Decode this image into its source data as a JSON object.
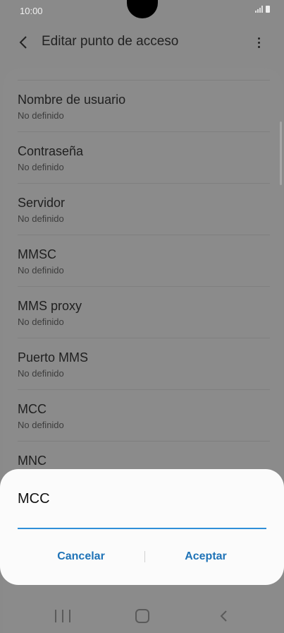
{
  "status_bar": {
    "time": "10:00"
  },
  "app_bar": {
    "title": "Editar punto de acceso"
  },
  "settings": [
    {
      "label": "Nombre de usuario",
      "value": "No definido"
    },
    {
      "label": "Contraseña",
      "value": "No definido"
    },
    {
      "label": "Servidor",
      "value": "No definido"
    },
    {
      "label": "MMSC",
      "value": "No definido"
    },
    {
      "label": "MMS proxy",
      "value": "No definido"
    },
    {
      "label": "Puerto MMS",
      "value": "No definido"
    },
    {
      "label": "MCC",
      "value": "No definido"
    },
    {
      "label": "MNC",
      "value": ""
    }
  ],
  "dialog": {
    "title": "MCC",
    "input_value": "",
    "cancel_label": "Cancelar",
    "accept_label": "Aceptar"
  },
  "colors": {
    "accent": "#2f8fd8",
    "button_text": "#1f73b7",
    "dim_background": "#8a8a8a"
  }
}
